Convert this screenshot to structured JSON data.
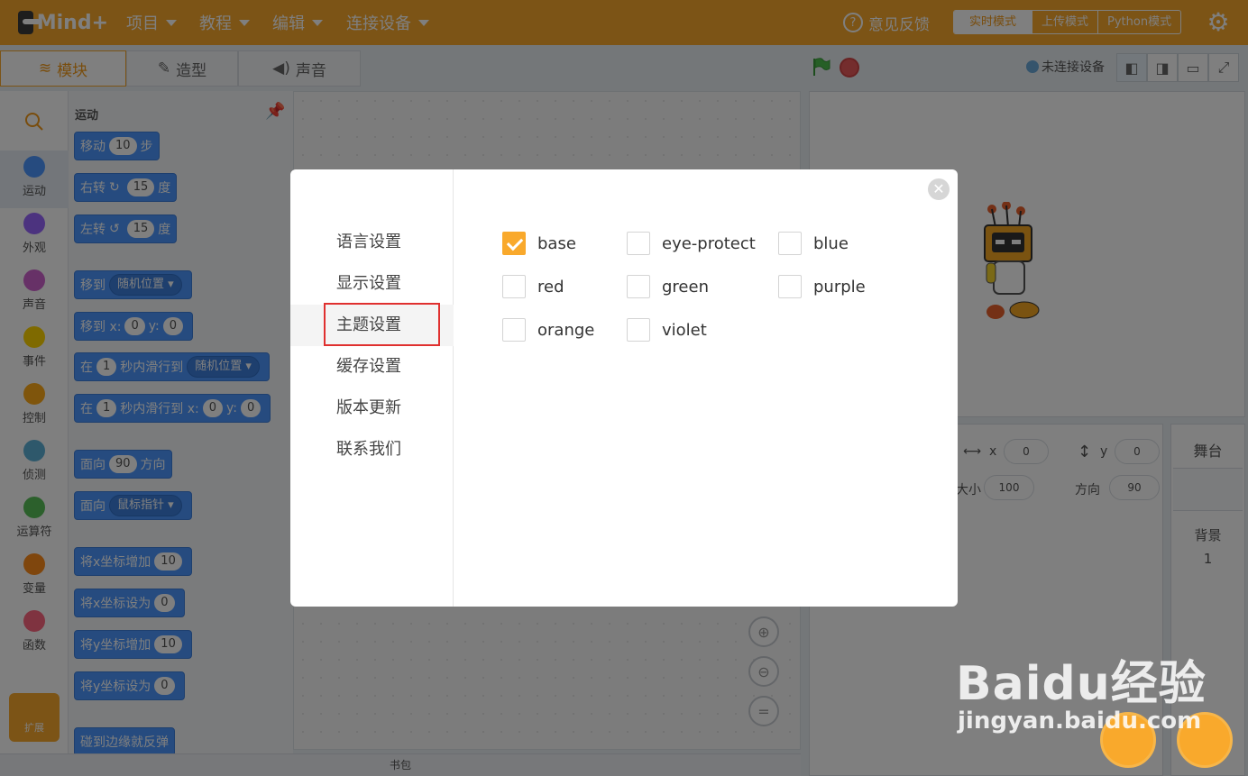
{
  "topbar": {
    "brand": "Mind+",
    "menus": [
      {
        "label": "项目"
      },
      {
        "label": "教程"
      },
      {
        "label": "编辑"
      },
      {
        "label": "连接设备"
      }
    ],
    "feedback": "意见反馈",
    "modes": [
      "实时模式",
      "上传模式",
      "Python模式"
    ],
    "active_mode": "实时模式"
  },
  "editor_tabs": [
    "模块",
    "造型",
    "声音"
  ],
  "connection_status": "未连接设备",
  "categories": [
    "运动",
    "外观",
    "声音",
    "事件",
    "控制",
    "侦测",
    "运算符",
    "变量",
    "函数"
  ],
  "category_colors": [
    "#4c97ff",
    "#9966ff",
    "#cf63cf",
    "#ffd500",
    "#ffab19",
    "#5cb1d6",
    "#59c059",
    "#ff8c1a",
    "#ff6680"
  ],
  "extensions_label": "扩展",
  "palette": {
    "title": "运动",
    "blocks": {
      "move": {
        "pre": "移动",
        "v": "10",
        "post": "步"
      },
      "turn_right": {
        "pre": "右转",
        "v": "15",
        "post": "度"
      },
      "turn_left": {
        "pre": "左转",
        "v": "15",
        "post": "度"
      },
      "goto": {
        "pre": "移到",
        "dd": "随机位置"
      },
      "goto_xy": {
        "pre": "移到 x:",
        "x": "0",
        "ymid": "y:",
        "y": "0"
      },
      "glide": {
        "pre": "在",
        "v": "1",
        "mid": "秒内滑行到",
        "dd": "随机位置"
      },
      "glide_xy": {
        "pre": "在",
        "v": "1",
        "mid": "秒内滑行到 x:",
        "x": "0",
        "ymid": "y:",
        "y": "0"
      },
      "point": {
        "pre": "面向",
        "v": "90",
        "post": "方向"
      },
      "point_towards": {
        "pre": "面向",
        "dd": "鼠标指针"
      },
      "change_x": {
        "pre": "将x坐标增加",
        "v": "10"
      },
      "set_x": {
        "pre": "将x坐标设为",
        "v": "0"
      },
      "change_y": {
        "pre": "将y坐标增加",
        "v": "10"
      },
      "set_y": {
        "pre": "将y坐标设为",
        "v": "0"
      },
      "bounce": {
        "pre": "碰到边缘就反弹"
      }
    }
  },
  "backpack_label": "书包",
  "sprite_info": {
    "x_label": "x",
    "x_value": "0",
    "y_label": "y",
    "y_value": "0",
    "size_label": "大小",
    "size_value": "100",
    "direction_label": "方向",
    "direction_value": "90"
  },
  "stage_panel": {
    "title": "舞台",
    "backdrop_label": "背景",
    "backdrop_count": "1"
  },
  "settings_dialog": {
    "nav": [
      "语言设置",
      "显示设置",
      "主题设置",
      "缓存设置",
      "版本更新",
      "联系我们"
    ],
    "active_nav": "主题设置",
    "themes": [
      {
        "name": "base",
        "checked": true
      },
      {
        "name": "eye-protect",
        "checked": false
      },
      {
        "name": "blue",
        "checked": false
      },
      {
        "name": "red",
        "checked": false
      },
      {
        "name": "green",
        "checked": false
      },
      {
        "name": "purple",
        "checked": false
      },
      {
        "name": "orange",
        "checked": false
      },
      {
        "name": "violet",
        "checked": false
      }
    ]
  },
  "watermark": {
    "brand": "Baidu经验",
    "url": "jingyan.baidu.com"
  },
  "accent_color": "#f9a92c"
}
